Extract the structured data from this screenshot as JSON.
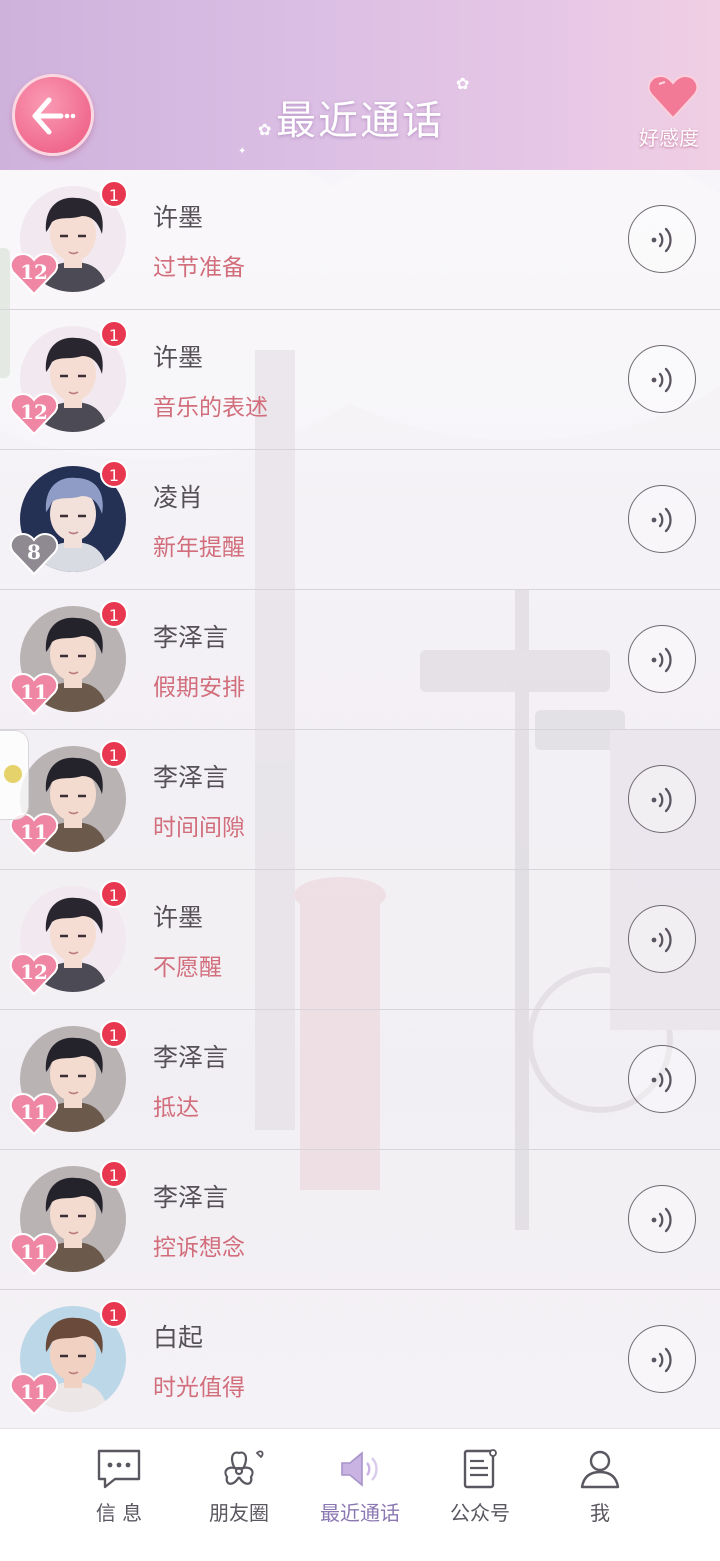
{
  "header": {
    "title": "最近通话",
    "back_icon": "back-arrow-icon",
    "affinity_label": "好感度",
    "affinity_icon": "heart-icon",
    "accent_color": "#f06a8e"
  },
  "calls": [
    {
      "name": "许墨",
      "topic": "过节准备",
      "badge": "1",
      "level": "12",
      "avatar": "xumo"
    },
    {
      "name": "许墨",
      "topic": "音乐的表述",
      "badge": "1",
      "level": "12",
      "avatar": "xumo"
    },
    {
      "name": "凌肖",
      "topic": "新年提醒",
      "badge": "1",
      "level": "8",
      "avatar": "lingxiao"
    },
    {
      "name": "李泽言",
      "topic": "假期安排",
      "badge": "1",
      "level": "11",
      "avatar": "lizeyan"
    },
    {
      "name": "李泽言",
      "topic": "时间间隙",
      "badge": "1",
      "level": "11",
      "avatar": "lizeyan"
    },
    {
      "name": "许墨",
      "topic": "不愿醒",
      "badge": "1",
      "level": "12",
      "avatar": "xumo"
    },
    {
      "name": "李泽言",
      "topic": "抵达",
      "badge": "1",
      "level": "11",
      "avatar": "lizeyan"
    },
    {
      "name": "李泽言",
      "topic": "控诉想念",
      "badge": "1",
      "level": "11",
      "avatar": "lizeyan"
    },
    {
      "name": "白起",
      "topic": "时光值得",
      "badge": "1",
      "level": "11",
      "avatar": "baiqi"
    }
  ],
  "tabbar": {
    "items": [
      {
        "label": "信 息",
        "icon": "chat-bubble-icon"
      },
      {
        "label": "朋友圈",
        "icon": "blossom-icon"
      },
      {
        "label": "最近通话",
        "icon": "speaker-icon",
        "active": true
      },
      {
        "label": "公众号",
        "icon": "newspaper-icon"
      },
      {
        "label": "我",
        "icon": "person-icon"
      }
    ]
  }
}
